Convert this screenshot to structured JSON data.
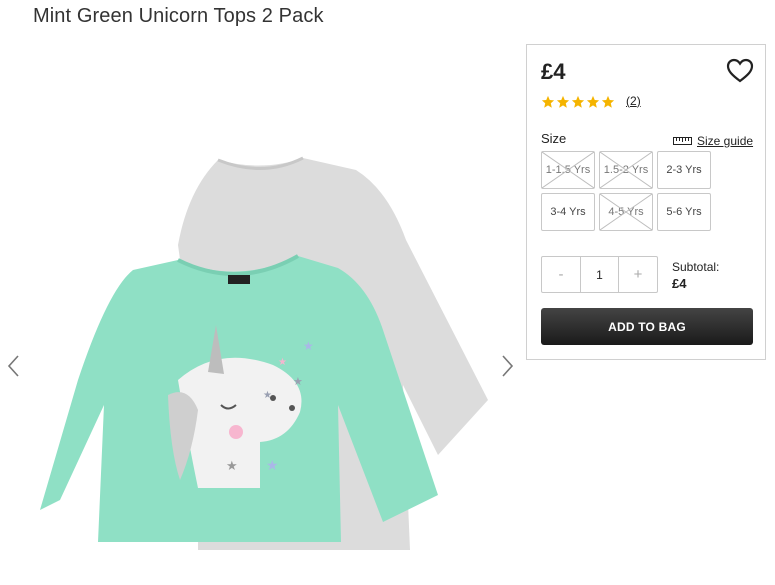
{
  "product": {
    "title": "Mint Green Unicorn Tops 2 Pack",
    "price": "£4",
    "rating": 5,
    "rating_max": 5,
    "review_count": "2",
    "colors": {
      "star": "#f5b400",
      "button": "#222222",
      "mint": "#8ee0c4",
      "grey_tee": "#d8d8d8"
    }
  },
  "size_selector": {
    "label": "Size",
    "guide_label": "Size guide",
    "options": [
      {
        "label": "1-1.5 Yrs",
        "available": false
      },
      {
        "label": "1.5-2 Yrs",
        "available": false
      },
      {
        "label": "2-3 Yrs",
        "available": true
      },
      {
        "label": "3-4 Yrs",
        "available": true
      },
      {
        "label": "4-5 Yrs",
        "available": false
      },
      {
        "label": "5-6 Yrs",
        "available": true
      }
    ]
  },
  "quantity": {
    "minus": "-",
    "value": "1",
    "plus": "+"
  },
  "subtotal": {
    "label": "Subtotal:",
    "amount": "£4"
  },
  "actions": {
    "add_to_bag": "ADD TO BAG"
  },
  "icons": {
    "prev": "chevron-left-icon",
    "next": "chevron-right-icon",
    "wishlist": "heart-icon",
    "size_guide": "ruler-icon"
  }
}
